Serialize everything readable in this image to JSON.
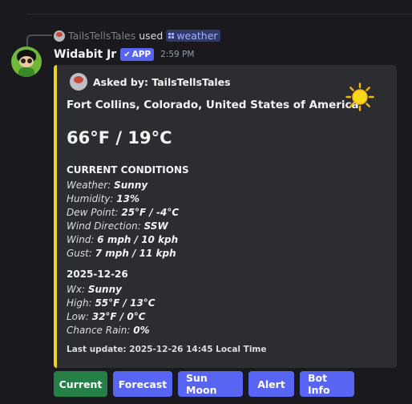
{
  "reply": {
    "user": "TailsTellsTales",
    "used": "used",
    "command": "weather"
  },
  "message": {
    "author": "Widabit Jr",
    "badge": "APP",
    "time": "2:59 PM"
  },
  "embed": {
    "accent_color": "#f0d020",
    "asked_by": "Asked by: TailsTellsTales",
    "location": "Fort Collins, Colorado, United States of America",
    "weather_icon": "sun-icon",
    "temperature": "66°F / 19°C",
    "current_title": "CURRENT CONDITIONS",
    "current": [
      {
        "label": "Weather:",
        "value": "Sunny"
      },
      {
        "label": "Humidity:",
        "value": "13%"
      },
      {
        "label": "Dew Point:",
        "value": "25°F / -4°C"
      },
      {
        "label": "Wind Direction:",
        "value": "SSW"
      },
      {
        "label": "Wind:",
        "value": "6 mph / 10 kph"
      },
      {
        "label": "Gust:",
        "value": "7 mph / 11 kph"
      }
    ],
    "forecast_title": "2025-12-26",
    "forecast": [
      {
        "label": "Wx:",
        "value": "Sunny"
      },
      {
        "label": "High:",
        "value": "55°F / 13°C"
      },
      {
        "label": "Low:",
        "value": "32°F / 0°C"
      },
      {
        "label": "Chance Rain:",
        "value": "0%"
      }
    ],
    "footer": "Last update: 2025-12-26 14:45 Local Time"
  },
  "buttons": [
    {
      "label": "Current",
      "style": "success"
    },
    {
      "label": "Forecast",
      "style": "primary"
    },
    {
      "label": "Sun Moon",
      "style": "primary"
    },
    {
      "label": "Alert",
      "style": "primary"
    },
    {
      "label": "Bot Info",
      "style": "primary"
    }
  ],
  "colors": {
    "background": "#1a1a1e",
    "embed_bg": "#2b2d31",
    "primary_button": "#5865f2",
    "success_button": "#248046"
  }
}
